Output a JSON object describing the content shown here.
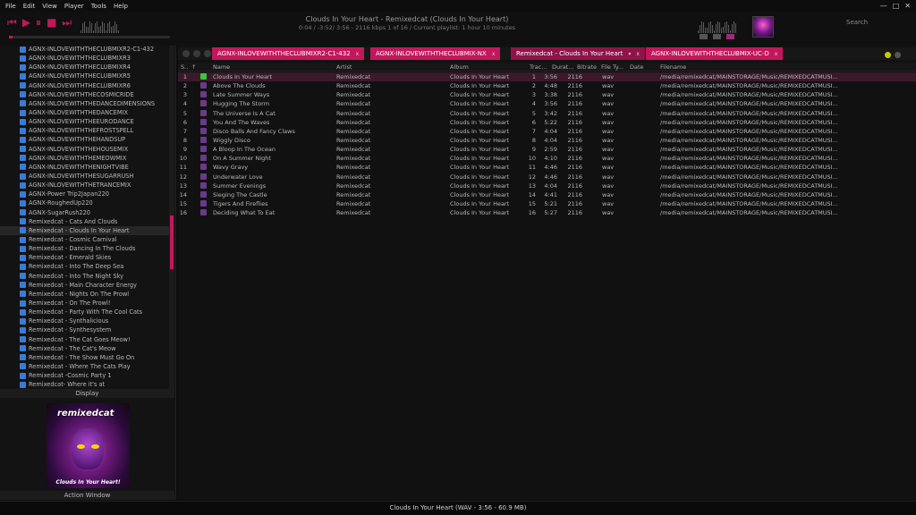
{
  "menu": [
    "File",
    "Edit",
    "View",
    "Player",
    "Tools",
    "Help"
  ],
  "window_controls": {
    "minimize": "—",
    "maximize": "□",
    "close": "✕"
  },
  "transport": {
    "prev": "⏮",
    "play": "▶",
    "pause": "⏸",
    "stop": "■",
    "next": "⏭"
  },
  "now_playing": {
    "title": "Clouds In Your Heart - Remixedcat  (Clouds In Your Heart)",
    "info": "0:04 / -3:52/ 3:56 - 2116 kbps   1 of 16 / Current  playlist: 1 hour 10 minutes"
  },
  "seek": {
    "position": 0.02
  },
  "search": {
    "placeholder": "Search"
  },
  "sidebar": {
    "items": [
      "AGNX-INLOVEWITHTHECLUBMIXR2-C1-432",
      "AGNX-INLOVEWITHTHECLUBMIXR3",
      "AGNX-INLOVEWITHTHECLUBMIXR4",
      "AGNX-INLOVEWITHTHECLUBMIXR5",
      "AGNX-INLOVEWITHTHECLUBMIXR6",
      "AGNX-INLOVEWITHTHECOSMICRIDE",
      "AGNX-INLOVEWITHTHEDANCEDIMENSIONS",
      "AGNX-INLOVEWITHTHEDANCEMIX",
      "AGNX-INLOVEWITHTHEEURODANCE",
      "AGNX-INLOVEWITHTHEFROSTSPELL",
      "AGNX-INLOVEWITHTHEHANDSUP",
      "AGNX-INLOVEWITHTHEHOUSEMIX",
      "AGNX-INLOVEWITHTHEMEOWMIX",
      "AGNX-INLOVEWITHTHENIGHTVIBE",
      "AGNX-INLOVEWITHTHESUGARRUSH",
      "AGNX-INLOVEWITHTHETRANCEMIX",
      "AGNX-Power Trip2Japan220",
      "AGNX-RoughedUp220",
      "AGNX-SugarRush220",
      "Remixedcat - Cats And Clouds",
      "Remixedcat - Clouds In Your Heart",
      "Remixedcat - Cosmic Carnival",
      "Remixedcat - Dancing In The Clouds",
      "Remixedcat - Emerald Skies",
      "Remixedcat - Into The Deep Sea",
      "Remixedcat - Into The Night Sky",
      "Remixedcat - Main Character Energy",
      "Remixedcat - Nights On The Prowl",
      "Remixedcat - On The Prowl!",
      "Remixedcat - Party With The Cool Cats",
      "Remixedcat - Synthalicious",
      "Remixedcat - Synthesystem",
      "Remixedcat - The Cat Goes Meow!",
      "Remixedcat - The Cat's Meow",
      "Remixedcat - The Show Must Go On",
      "Remixedcat - Where The Cats Play",
      "Remixedcat -Cosmic Party 1",
      "Remixedcat- Where it's at"
    ],
    "selected_index": 20,
    "display_header": "Display",
    "action_header": "Action Window"
  },
  "album_art": {
    "logo": "remixedcat",
    "caption": "Clouds In Your Heart!"
  },
  "tabs": [
    {
      "label": "AGNX-INLOVEWITHTHECLUBMIXR2-C1-432",
      "close": "x"
    },
    {
      "label": "AGNX-INLOVEWITHTHECLUBMIX-NX",
      "close": "x"
    },
    {
      "label": "Remixedcat - Clouds In Your Heart",
      "close": "x",
      "active": true
    },
    {
      "label": "AGNX-INLOVEWITHTHECLUBMIX-UC-D",
      "close": "x"
    }
  ],
  "columns": [
    "S..",
    "↑",
    "Name",
    "Artist",
    "Album",
    "Trac...",
    "Durat...",
    "Bitrate",
    "File Ty...",
    "Date",
    "Filename"
  ],
  "tracks": [
    {
      "n": "1",
      "name": "Clouds In Your Heart",
      "artist": "Remixedcat",
      "album": "Clouds In Your Heart",
      "track": "1",
      "duration": "3:56",
      "bitrate": "2116",
      "type": "wav",
      "file": "/media/remixedcat/MAINSTORAGE/Music/REMIXEDCATMUSI..."
    },
    {
      "n": "2",
      "name": "Above The Clouds",
      "artist": "Remixedcat",
      "album": "Clouds In Your Heart",
      "track": "2",
      "duration": "4:48",
      "bitrate": "2116",
      "type": "wav",
      "file": "/media/remixedcat/MAINSTORAGE/Music/REMIXEDCATMUSI..."
    },
    {
      "n": "3",
      "name": "Late Summer Ways",
      "artist": "Remixedcat",
      "album": "Clouds In Your Heart",
      "track": "3",
      "duration": "3:38",
      "bitrate": "2116",
      "type": "wav",
      "file": "/media/remixedcat/MAINSTORAGE/Music/REMIXEDCATMUSI..."
    },
    {
      "n": "4",
      "name": "Hugging The Storm",
      "artist": "Remixedcat",
      "album": "Clouds In Your Heart",
      "track": "4",
      "duration": "3:56",
      "bitrate": "2116",
      "type": "wav",
      "file": "/media/remixedcat/MAINSTORAGE/Music/REMIXEDCATMUSI..."
    },
    {
      "n": "5",
      "name": "The Universe Is A Cat",
      "artist": "Remixedcat",
      "album": "Clouds In Your Heart",
      "track": "5",
      "duration": "3:42",
      "bitrate": "2116",
      "type": "wav",
      "file": "/media/remixedcat/MAINSTORAGE/Music/REMIXEDCATMUSI..."
    },
    {
      "n": "6",
      "name": "You And The Waves",
      "artist": "Remixedcat",
      "album": "Clouds In Your Heart",
      "track": "6",
      "duration": "5:22",
      "bitrate": "2116",
      "type": "wav",
      "file": "/media/remixedcat/MAINSTORAGE/Music/REMIXEDCATMUSI..."
    },
    {
      "n": "7",
      "name": "Disco Balls And Fancy Claws",
      "artist": "Remixedcat",
      "album": "Clouds In Your Heart",
      "track": "7",
      "duration": "4:04",
      "bitrate": "2116",
      "type": "wav",
      "file": "/media/remixedcat/MAINSTORAGE/Music/REMIXEDCATMUSI..."
    },
    {
      "n": "8",
      "name": "Wiggly Disco",
      "artist": "Remixedcat",
      "album": "Clouds In Your Heart",
      "track": "8",
      "duration": "4:04",
      "bitrate": "2116",
      "type": "wav",
      "file": "/media/remixedcat/MAINSTORAGE/Music/REMIXEDCATMUSI..."
    },
    {
      "n": "9",
      "name": "A Bloop In The Ocean",
      "artist": "Remixedcat",
      "album": "Clouds In Your Heart",
      "track": "9",
      "duration": "2:59",
      "bitrate": "2116",
      "type": "wav",
      "file": "/media/remixedcat/MAINSTORAGE/Music/REMIXEDCATMUSI..."
    },
    {
      "n": "10",
      "name": "On A Summer Night",
      "artist": "Remixedcat",
      "album": "Clouds In Your Heart",
      "track": "10",
      "duration": "4:10",
      "bitrate": "2116",
      "type": "wav",
      "file": "/media/remixedcat/MAINSTORAGE/Music/REMIXEDCATMUSI..."
    },
    {
      "n": "11",
      "name": "Wavy Gravy",
      "artist": "Remixedcat",
      "album": "Clouds In Your Heart",
      "track": "11",
      "duration": "4:46",
      "bitrate": "2116",
      "type": "wav",
      "file": "/media/remixedcat/MAINSTORAGE/Music/REMIXEDCATMUSI..."
    },
    {
      "n": "12",
      "name": "Underwater Love",
      "artist": "Remixedcat",
      "album": "Clouds In Your Heart",
      "track": "12",
      "duration": "4:46",
      "bitrate": "2116",
      "type": "wav",
      "file": "/media/remixedcat/MAINSTORAGE/Music/REMIXEDCATMUSI..."
    },
    {
      "n": "13",
      "name": "Summer Evenings",
      "artist": "Remixedcat",
      "album": "Clouds In Your Heart",
      "track": "13",
      "duration": "4:04",
      "bitrate": "2116",
      "type": "wav",
      "file": "/media/remixedcat/MAINSTORAGE/Music/REMIXEDCATMUSI..."
    },
    {
      "n": "14",
      "name": "Sieging The Castle",
      "artist": "Remixedcat",
      "album": "Clouds In Your Heart",
      "track": "14",
      "duration": "4:41",
      "bitrate": "2116",
      "type": "wav",
      "file": "/media/remixedcat/MAINSTORAGE/Music/REMIXEDCATMUSI..."
    },
    {
      "n": "15",
      "name": "Tigers And Fireflies",
      "artist": "Remixedcat",
      "album": "Clouds In Your Heart",
      "track": "15",
      "duration": "5:21",
      "bitrate": "2116",
      "type": "wav",
      "file": "/media/remixedcat/MAINSTORAGE/Music/REMIXEDCATMUSI..."
    },
    {
      "n": "16",
      "name": "Deciding What To Eat",
      "artist": "Remixedcat",
      "album": "Clouds In Your Heart",
      "track": "16",
      "duration": "5:27",
      "bitrate": "2116",
      "type": "wav",
      "file": "/media/remixedcat/MAINSTORAGE/Music/REMIXEDCATMUSI..."
    }
  ],
  "selected_track": 0,
  "status": "Clouds In Your Heart (WAV - 3:56 - 60.9 MB)",
  "colors": {
    "accent": "#c2185b",
    "accent_dark": "#8e1448",
    "background": "#0d0d0d",
    "playing": "#3cc43c"
  }
}
